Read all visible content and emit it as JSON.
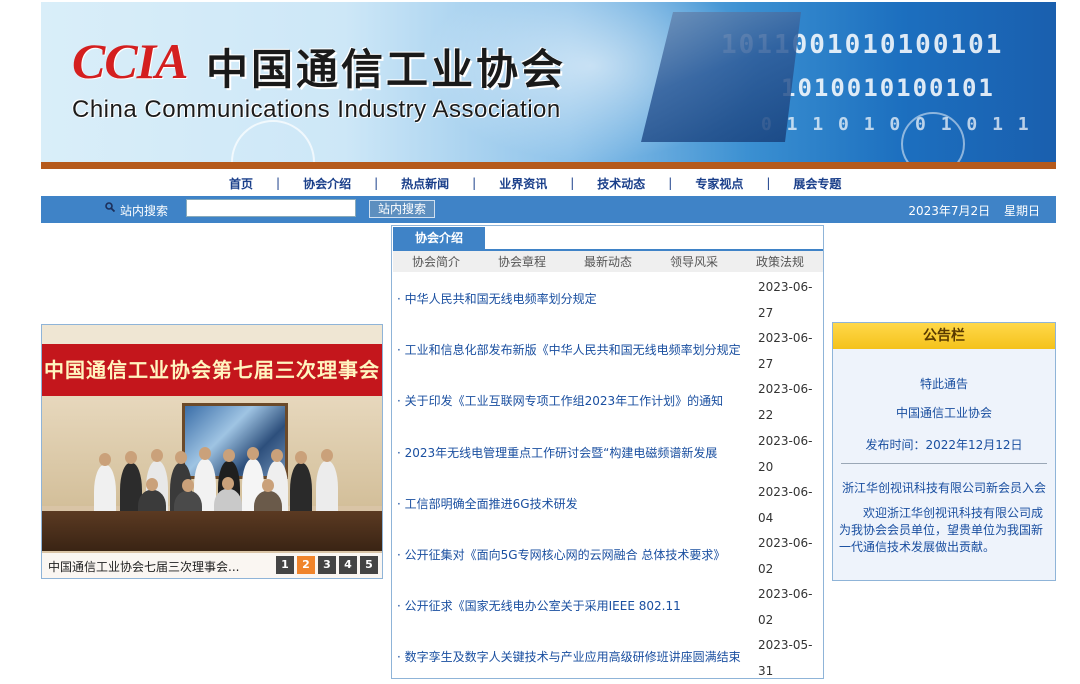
{
  "banner": {
    "logo_abbr": "CCIA",
    "logo_cn": "中国通信工业协会",
    "logo_en": "China Communications Industry Association"
  },
  "nav": {
    "items": [
      "首页",
      "协会介绍",
      "热点新闻",
      "业界资讯",
      "技术动态",
      "专家视点",
      "展会专题"
    ],
    "separator": "|"
  },
  "search": {
    "label": "站内搜索",
    "input_value": "",
    "button_label": "站内搜索",
    "date": "2023年7月2日",
    "weekday": "星期日"
  },
  "slideshow": {
    "banner_text": "中国通信工业协会第七届三次理事会议",
    "caption": "中国通信工业协会七届三次理事会...",
    "pages": [
      "1",
      "2",
      "3",
      "4",
      "5"
    ],
    "active_page": 2
  },
  "news": {
    "tab_label": "协会介绍",
    "subnav": [
      "协会简介",
      "协会章程",
      "最新动态",
      "领导风采",
      "政策法规"
    ],
    "items": [
      {
        "title": "· 中华人民共和国无线电频率划分规定",
        "date_a": "2023-06-",
        "date_b": "27"
      },
      {
        "title": "· 工业和信息化部发布新版《中华人民共和国无线电频率划分规定",
        "date_a": "2023-06-",
        "date_b": "27"
      },
      {
        "title": "· 关于印发《工业互联网专项工作组2023年工作计划》的通知",
        "date_a": "2023-06-",
        "date_b": "22"
      },
      {
        "title": "· 2023年无线电管理重点工作研讨会暨“构建电磁频谱新发展",
        "date_a": "2023-06-",
        "date_b": "20"
      },
      {
        "title": "· 工信部明确全面推进6G技术研发",
        "date_a": "2023-06-",
        "date_b": "04"
      },
      {
        "title": "· 公开征集对《面向5G专网核心网的云网融合 总体技术要求》",
        "date_a": "2023-06-",
        "date_b": "02"
      },
      {
        "title": "· 公开征求《国家无线电办公室关于采用IEEE 802.11",
        "date_a": "2023-06-",
        "date_b": "02"
      },
      {
        "title": "· 数字孪生及数字人关键技术与产业应用高级研修班讲座圆满结束",
        "date_a": "2023-05-",
        "date_b": "31"
      }
    ]
  },
  "notice": {
    "title": "公告栏",
    "line_special": "特此通告",
    "line_org": "中国通信工业协会",
    "line_time": "发布时间：2022年12月12日",
    "member_title": "浙江华创视讯科技有限公司新会员入会",
    "member_para": "欢迎浙江华创视讯科技有限公司成为我协会会员单位，望贵单位为我国新一代通信技术发展做出贡献。"
  },
  "colors": {
    "nav_blue": "#1a3f8a",
    "bar_blue": "#3f83c7",
    "link_blue": "#1a4fa0",
    "accent_orange": "#f0842b",
    "notice_yellow": "#f4c21b",
    "banner_brown": "#b55a1c"
  }
}
